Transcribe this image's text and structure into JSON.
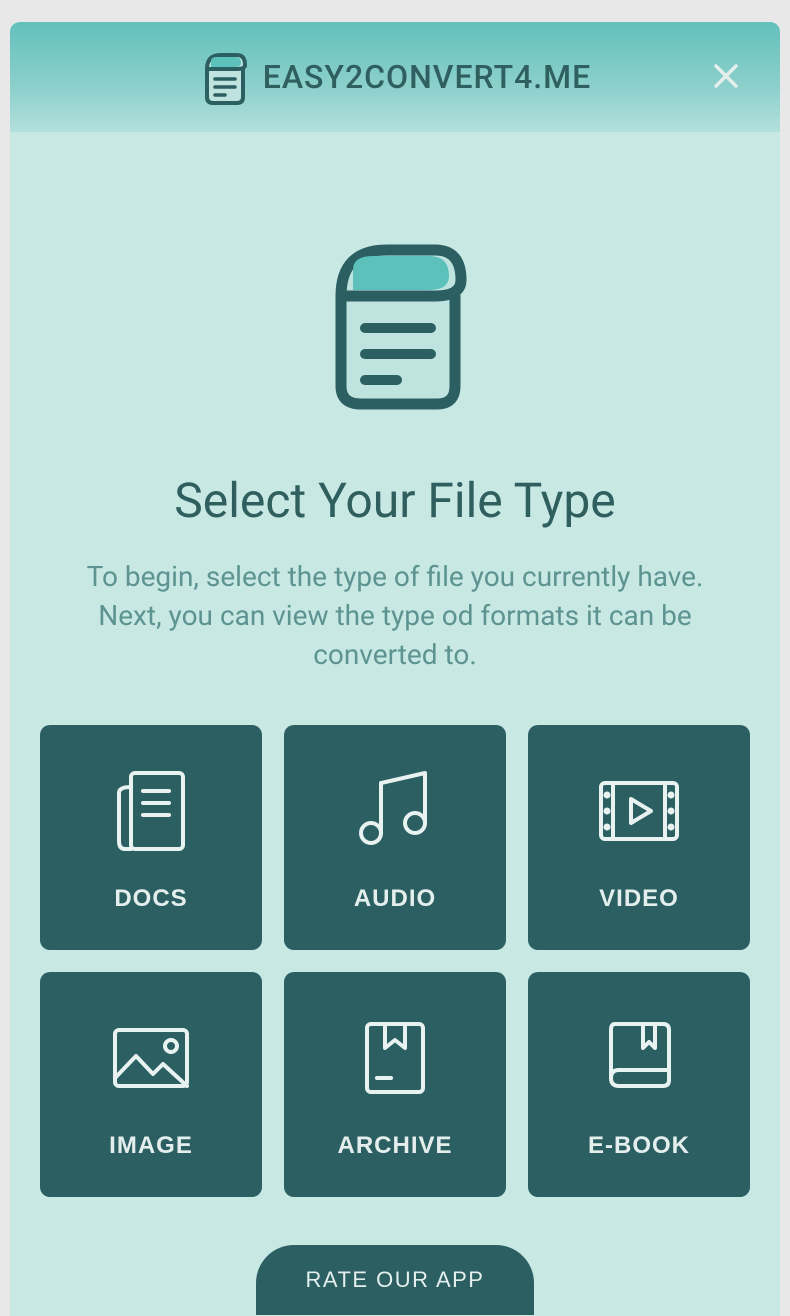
{
  "header": {
    "title": "EASY2CONVERT4.ME"
  },
  "main": {
    "title": "Select Your File Type",
    "subtitle": "To begin, select the type of file you currently have. Next, you can view the type od formats it can be converted to."
  },
  "tiles": [
    {
      "label": "DOCS",
      "icon": "docs"
    },
    {
      "label": "AUDIO",
      "icon": "audio"
    },
    {
      "label": "VIDEO",
      "icon": "video"
    },
    {
      "label": "IMAGE",
      "icon": "image"
    },
    {
      "label": "ARCHIVE",
      "icon": "archive"
    },
    {
      "label": "E-BOOK",
      "icon": "ebook"
    }
  ],
  "footer": {
    "rate_label": "RATE OUR APP"
  }
}
